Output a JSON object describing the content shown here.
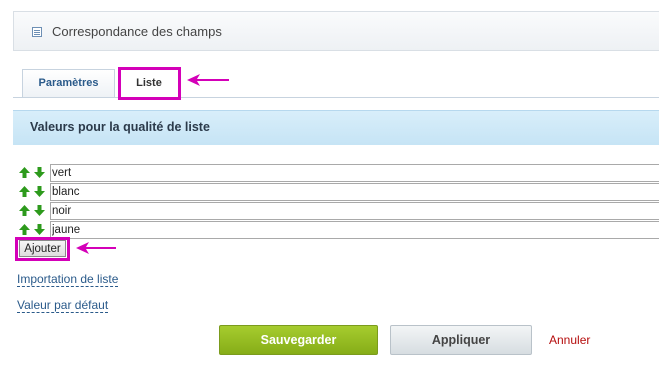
{
  "header": {
    "title": "Correspondance des champs",
    "icon": "document-icon"
  },
  "tabs": [
    {
      "label": "Paramètres",
      "active": false
    },
    {
      "label": "Liste",
      "active": true
    }
  ],
  "section": {
    "title": "Valeurs pour la qualité de liste"
  },
  "list_values": [
    "vert",
    "blanc",
    "noir",
    "jaune"
  ],
  "list_controls": {
    "up_icon": "arrow-up-icon",
    "down_icon": "arrow-down-icon"
  },
  "add_button": {
    "label": "Ajouter"
  },
  "links": {
    "import": "Importation de liste",
    "default_value": "Valeur par défaut"
  },
  "buttons": {
    "save": "Sauvegarder",
    "apply": "Appliquer",
    "cancel": "Annuler"
  },
  "colors": {
    "highlight": "#d400b8",
    "save_green": "#96bd22",
    "cancel_red": "#b50d0d",
    "section_bg": "#cfe9f8",
    "arrow_green": "#2d9a1c"
  }
}
